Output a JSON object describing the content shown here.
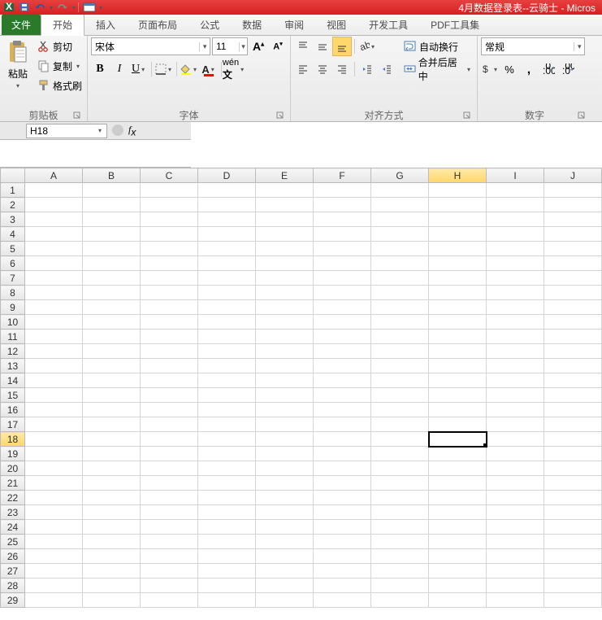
{
  "title": "4月数据登录表--云骑士 - Micros",
  "tabs": {
    "file": "文件",
    "home": "开始",
    "insert": "插入",
    "layout": "页面布局",
    "formula": "公式",
    "data": "数据",
    "review": "审阅",
    "view": "视图",
    "dev": "开发工具",
    "pdf": "PDF工具集"
  },
  "clipboard": {
    "paste": "粘贴",
    "cut": "剪切",
    "copy": "复制",
    "painter": "格式刷",
    "label": "剪贴板"
  },
  "font": {
    "name": "宋体",
    "size": "11",
    "label": "字体"
  },
  "align": {
    "wrap": "自动换行",
    "merge": "合并后居中",
    "label": "对齐方式"
  },
  "number": {
    "format": "常规",
    "percent": "%",
    "comma": ",",
    "label": "数字"
  },
  "cellref": "H18",
  "cols": [
    "A",
    "B",
    "C",
    "D",
    "E",
    "F",
    "G",
    "H",
    "I",
    "J"
  ],
  "rows": 29,
  "active": {
    "row": 18,
    "col": "H"
  }
}
